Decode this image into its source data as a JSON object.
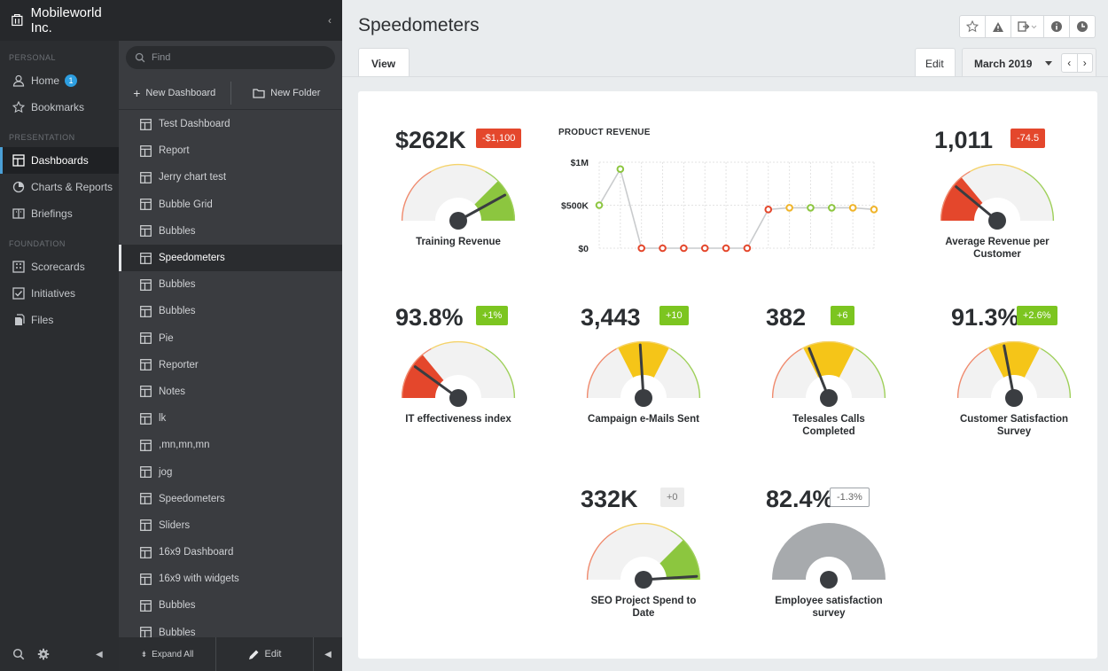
{
  "nav": {
    "org_name": "Mobileworld Inc.",
    "sections": {
      "personal": "PERSONAL",
      "presentation": "PRESENTATION",
      "foundation": "FOUNDATION"
    },
    "items": {
      "home": "Home",
      "home_badge": "1",
      "bookmarks": "Bookmarks",
      "dashboards": "Dashboards",
      "charts": "Charts & Reports",
      "briefings": "Briefings",
      "scorecards": "Scorecards",
      "initiatives": "Initiatives",
      "files": "Files"
    }
  },
  "panel": {
    "find_placeholder": "Find",
    "new_dashboard": "New Dashboard",
    "new_folder": "New Folder",
    "items": [
      "Test Dashboard",
      "Report",
      "Jerry chart test",
      "Bubble Grid",
      "Bubbles",
      "Speedometers",
      "Bubbles",
      "Bubbles",
      "Pie",
      "Reporter",
      "Notes",
      "lk",
      ",mn,mn,mn",
      "jog",
      "Speedometers",
      "Sliders",
      "16x9 Dashboard",
      "16x9 with widgets",
      "Bubbles",
      "Bubbles"
    ],
    "active_index": 5,
    "expand_all": "Expand All",
    "edit": "Edit"
  },
  "main": {
    "title": "Speedometers",
    "view_tab": "View",
    "edit_tab": "Edit",
    "month": "March 2019"
  },
  "gauges": [
    {
      "value": "$262K",
      "delta": "-$1,100",
      "delta_style": "red",
      "label": [
        "Training Revenue"
      ],
      "needle_fraction": 0.84,
      "band": "green-high"
    },
    {
      "value": "1,011",
      "delta": "-74.5",
      "delta_style": "red",
      "label": [
        "Average Revenue per",
        "Customer"
      ],
      "needle_fraction": 0.22,
      "band": "red-low"
    },
    {
      "value": "93.8%",
      "delta": "+1%",
      "delta_style": "green",
      "label": [
        "IT effectiveness index"
      ],
      "needle_fraction": 0.2,
      "band": "red-low"
    },
    {
      "value": "3,443",
      "delta": "+10",
      "delta_style": "green",
      "label": [
        "Campaign e-Mails Sent"
      ],
      "needle_fraction": 0.48,
      "band": "yellow-mid"
    },
    {
      "value": "382",
      "delta": "+6",
      "delta_style": "green",
      "label": [
        "Telesales Calls",
        "Completed"
      ],
      "needle_fraction": 0.38,
      "band": "yellow-mid"
    },
    {
      "value": "91.3%",
      "delta": "+2.6%",
      "delta_style": "green",
      "label": [
        "Customer Satisfaction",
        "Survey"
      ],
      "needle_fraction": 0.44,
      "band": "yellow-mid"
    },
    {
      "value": "332K",
      "delta": "+0",
      "delta_style": "grey",
      "label": [
        "SEO Project Spend to",
        "Date"
      ],
      "needle_fraction": 0.98,
      "band": "green-high"
    },
    {
      "value": "82.4%",
      "delta": "-1.3%",
      "delta_style": "outline",
      "label": [
        "Employee satisfaction",
        "survey"
      ],
      "needle_fraction": null,
      "band": "none"
    }
  ],
  "chart_data": {
    "type": "line",
    "title": "PRODUCT REVENUE",
    "y_tick_labels": [
      "$1M",
      "$500K",
      "$0"
    ],
    "ylim": [
      0,
      1000000
    ],
    "grid": true,
    "series": [
      {
        "values": [
          500000,
          920000,
          0,
          0,
          0,
          0,
          0,
          0,
          450000,
          470000,
          470000,
          470000,
          470000,
          450000
        ],
        "point_colors": [
          "#8cc63f",
          "#8cc63f",
          "#e4472c",
          "#e4472c",
          "#e4472c",
          "#e4472c",
          "#e4472c",
          "#e4472c",
          "#e4472c",
          "#f0b429",
          "#8cc63f",
          "#8cc63f",
          "#f0b429",
          "#f0b429"
        ]
      }
    ]
  },
  "colors": {
    "red": "#e4472c",
    "green": "#8cc63f",
    "yellow": "#f5c518",
    "accent": "#2d9ee0"
  }
}
